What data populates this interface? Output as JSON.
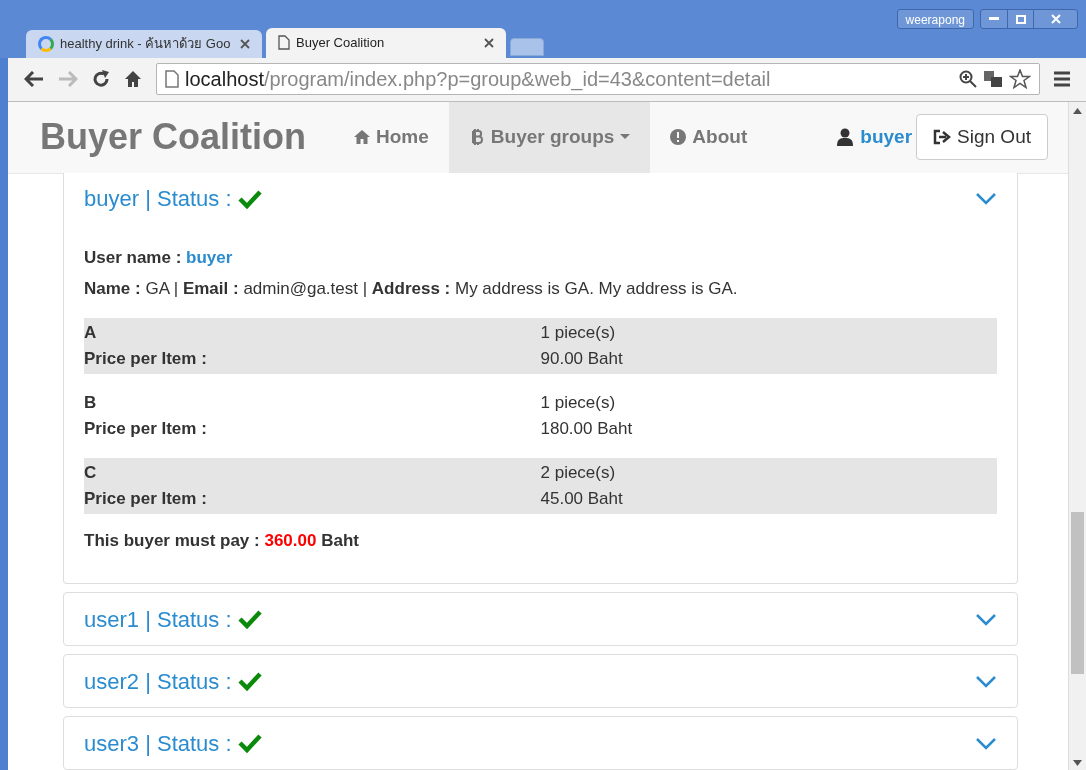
{
  "browser": {
    "profile": "weerapong",
    "tabs": [
      {
        "title": "healthy drink - ค้นหาด้วย Goo",
        "selected": false,
        "kind": "google"
      },
      {
        "title": "Buyer Coalition",
        "selected": true,
        "kind": "page"
      }
    ],
    "address": {
      "host": "localhost",
      "path": "/program/index.php?p=group&web_id=43&content=detail"
    }
  },
  "navbar": {
    "brand": "Buyer Coalition",
    "items": [
      {
        "label": "Home",
        "kind": "home",
        "selected": false,
        "dropdown": false
      },
      {
        "label": "Buyer groups",
        "kind": "bitcoin",
        "selected": true,
        "dropdown": true
      },
      {
        "label": "About",
        "kind": "info",
        "selected": false,
        "dropdown": false
      }
    ],
    "user": "buyer",
    "sign_out": "Sign Out"
  },
  "panels": [
    {
      "title": "buyer | Status :",
      "approved": true,
      "expanded": true,
      "username_label": "User name :",
      "username": "buyer",
      "details": "**Name :** GA | **Email :** admin@ga.test | **Address :** My address is GA. My address is GA.",
      "items": [
        {
          "name": "A",
          "price_label": "Price per Item :",
          "quantity": "1 piece(s)",
          "price": "90.00 Baht"
        },
        {
          "name": "B",
          "price_label": "Price per Item :",
          "quantity": "1 piece(s)",
          "price": "180.00 Baht"
        },
        {
          "name": "C",
          "price_label": "Price per Item :",
          "quantity": "2 piece(s)",
          "price": "45.00 Baht"
        }
      ],
      "total": {
        "label": "This buyer must pay :",
        "amount": "360.00",
        "unit": "Baht"
      }
    },
    {
      "title": "user1 | Status :",
      "approved": true,
      "expanded": false
    },
    {
      "title": "user2 | Status :",
      "approved": true,
      "expanded": false
    },
    {
      "title": "user3 | Status :",
      "approved": true,
      "expanded": false
    }
  ]
}
